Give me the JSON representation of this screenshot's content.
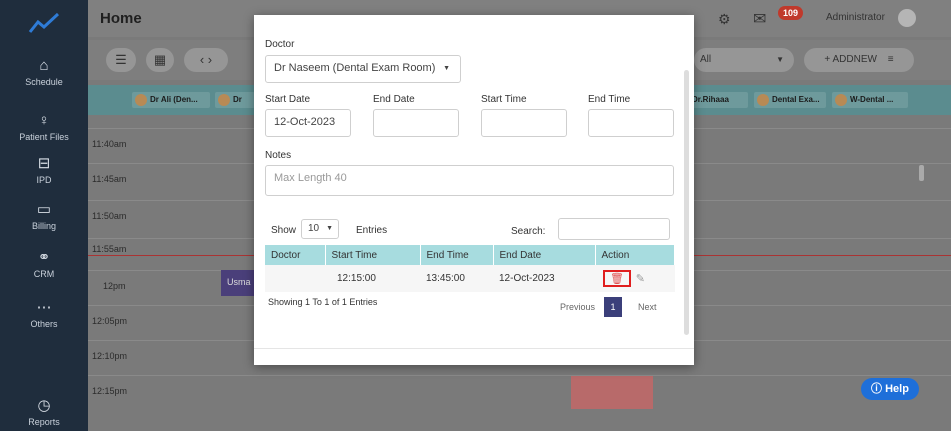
{
  "sidebar": {
    "items": [
      {
        "label": "Schedule",
        "icon": "home-icon"
      },
      {
        "label": "Patient Files",
        "icon": "person-icon"
      },
      {
        "label": "IPD",
        "icon": "bed-icon"
      },
      {
        "label": "Billing",
        "icon": "billing-icon"
      },
      {
        "label": "CRM",
        "icon": "crm-icon"
      },
      {
        "label": "Others",
        "icon": "more-icon"
      },
      {
        "label": "Reports",
        "icon": "reports-icon"
      }
    ]
  },
  "header": {
    "title": "Home",
    "notification_count": "109",
    "user": "Administrator"
  },
  "toolbar": {
    "filter_value": "All",
    "add_new_label": "+ ADDNEW"
  },
  "doctor_columns": [
    "Dr Ali (Den...",
    "Dr",
    "Dr.Rihaaa",
    "Dental Exa...",
    "W-Dental ..."
  ],
  "time_slots": [
    "11:40am",
    "11:45am",
    "11:50am",
    "11:55am",
    "12pm",
    "12:05pm",
    "12:10pm",
    "12:15pm"
  ],
  "appointment_label": "Usma",
  "modal": {
    "doctor_label": "Doctor",
    "doctor_value": "Dr Naseem (Dental Exam Room)",
    "start_date_label": "Start Date",
    "start_date_value": "12-Oct-2023",
    "end_date_label": "End Date",
    "start_time_label": "Start Time",
    "end_time_label": "End Time",
    "notes_label": "Notes",
    "notes_placeholder": "Max Length 40",
    "show_label": "Show",
    "entries_value": "10",
    "entries_label": "Entries",
    "search_label": "Search:",
    "columns": [
      "Doctor",
      "Start Time",
      "End Time",
      "End Date",
      "Action"
    ],
    "rows": [
      {
        "doctor": "",
        "start_time": "12:15:00",
        "end_time": "13:45:00",
        "end_date": "12-Oct-2023"
      }
    ],
    "showing_text": "Showing 1 To 1 of 1 Entries",
    "prev_label": "Previous",
    "page": "1",
    "next_label": "Next"
  },
  "help_label": "Help"
}
